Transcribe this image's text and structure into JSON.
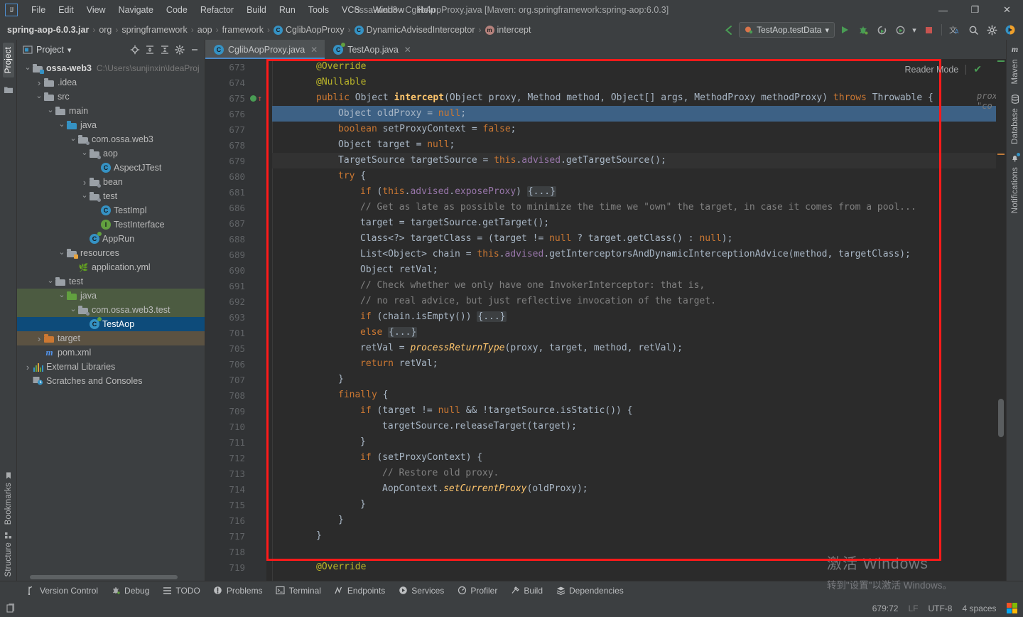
{
  "window": {
    "title": "ossa-web3 - CglibAopProxy.java [Maven: org.springframework:spring-aop:6.0.3]",
    "logo_text": "IJ",
    "minimize": "—",
    "maximize": "❐",
    "close": "✕"
  },
  "menubar": {
    "items": [
      "File",
      "Edit",
      "View",
      "Navigate",
      "Code",
      "Refactor",
      "Build",
      "Run",
      "Tools",
      "VCS",
      "Window",
      "Help"
    ]
  },
  "breadcrumb": {
    "items": [
      {
        "label": "spring-aop-6.0.3.jar",
        "icon": "",
        "bold": true
      },
      {
        "label": "org",
        "icon": ""
      },
      {
        "label": "springframework",
        "icon": ""
      },
      {
        "label": "aop",
        "icon": ""
      },
      {
        "label": "framework",
        "icon": ""
      },
      {
        "label": "CglibAopProxy",
        "icon": "class-icon"
      },
      {
        "label": "DynamicAdvisedInterceptor",
        "icon": "class-icon"
      },
      {
        "label": "intercept",
        "icon": "method-icon"
      }
    ],
    "separator": "›"
  },
  "toolbar": {
    "run_config": "TestAop.testData",
    "run_config_chevron": "▾",
    "icons": [
      {
        "name": "run-icon",
        "glyph": "▶"
      },
      {
        "name": "debug-icon",
        "glyph": "🐞"
      },
      {
        "name": "run-with-coverage-icon",
        "glyph": "↻"
      },
      {
        "name": "profiler-run-icon",
        "glyph": "⟳"
      },
      {
        "name": "stop-icon",
        "glyph": "■"
      },
      {
        "name": "translate-icon",
        "glyph": "文A"
      },
      {
        "name": "search-everywhere-icon",
        "glyph": "🔍"
      },
      {
        "name": "settings-icon",
        "glyph": "⚙"
      },
      {
        "name": "ide-assistant-icon",
        "glyph": "◗"
      }
    ],
    "back_arrow": "↖"
  },
  "left_strip": {
    "top": "Project",
    "bottom": [
      "Bookmarks",
      "Structure"
    ]
  },
  "right_strip": {
    "items": [
      "Maven",
      "Database",
      "Notifications"
    ]
  },
  "project_panel": {
    "title": "Project",
    "chevron": "▾",
    "actions": [
      "locate-icon",
      "expand-all-icon",
      "collapse-all-icon",
      "settings-icon",
      "hide-icon"
    ],
    "tree": [
      {
        "depth": 0,
        "arrow": "▾",
        "icon": "module-folder",
        "label": "ossa-web3",
        "bold": true,
        "hint": "C:\\Users\\sunjinxin\\IdeaProj",
        "state": "none"
      },
      {
        "depth": 1,
        "arrow": "›",
        "icon": "folder",
        "label": ".idea",
        "state": "none"
      },
      {
        "depth": 1,
        "arrow": "▾",
        "icon": "folder",
        "label": "src",
        "state": "none"
      },
      {
        "depth": 2,
        "arrow": "▾",
        "icon": "folder",
        "label": "main",
        "state": "none"
      },
      {
        "depth": 3,
        "arrow": "▾",
        "icon": "folder-blue",
        "label": "java",
        "state": "none"
      },
      {
        "depth": 4,
        "arrow": "▾",
        "icon": "package",
        "label": "com.ossa.web3",
        "state": "none"
      },
      {
        "depth": 5,
        "arrow": "▾",
        "icon": "package",
        "label": "aop",
        "state": "none"
      },
      {
        "depth": 6,
        "arrow": "",
        "icon": "class",
        "label": "AspectJTest",
        "state": "none"
      },
      {
        "depth": 5,
        "arrow": "›",
        "icon": "package",
        "label": "bean",
        "state": "none"
      },
      {
        "depth": 5,
        "arrow": "▾",
        "icon": "package",
        "label": "test",
        "state": "none"
      },
      {
        "depth": 6,
        "arrow": "",
        "icon": "class",
        "label": "TestImpl",
        "state": "none"
      },
      {
        "depth": 6,
        "arrow": "",
        "icon": "interface",
        "label": "TestInterface",
        "state": "none"
      },
      {
        "depth": 5,
        "arrow": "",
        "icon": "runnable-class",
        "label": "AppRun",
        "state": "none"
      },
      {
        "depth": 3,
        "arrow": "▾",
        "icon": "resources-folder",
        "label": "resources",
        "state": "none"
      },
      {
        "depth": 4,
        "arrow": "",
        "icon": "yaml",
        "label": "application.yml",
        "state": "none"
      },
      {
        "depth": 2,
        "arrow": "▾",
        "icon": "folder",
        "label": "test",
        "state": "none"
      },
      {
        "depth": 3,
        "arrow": "▾",
        "icon": "folder-green",
        "label": "java",
        "state": "green"
      },
      {
        "depth": 4,
        "arrow": "▾",
        "icon": "package",
        "label": "com.ossa.web3.test",
        "state": "green"
      },
      {
        "depth": 5,
        "arrow": "",
        "icon": "runnable-class",
        "label": "TestAop",
        "state": "blue"
      },
      {
        "depth": 1,
        "arrow": "›",
        "icon": "folder-orange",
        "label": "target",
        "state": "brown"
      },
      {
        "depth": 1,
        "arrow": "",
        "icon": "maven",
        "label": "pom.xml",
        "state": "none"
      },
      {
        "depth": 0,
        "arrow": "›",
        "icon": "libraries",
        "label": "External Libraries",
        "state": "none"
      },
      {
        "depth": 0,
        "arrow": "",
        "icon": "scratches",
        "label": "Scratches and Consoles",
        "state": "none"
      }
    ]
  },
  "tabs": [
    {
      "label": "CglibAopProxy.java",
      "icon": "class-icon",
      "active": true,
      "close": "✕"
    },
    {
      "label": "TestAop.java",
      "icon": "runnable-class-icon",
      "active": false,
      "close": "✕"
    }
  ],
  "editor": {
    "reader_mode_label": "Reader Mode",
    "reader_mode_check": "✔",
    "inlay_hint": "proxy: \"co",
    "lines": [
      {
        "num": "673",
        "fold": "minus",
        "indent": 2,
        "html": "<span class=\"ann\">@Override</span>"
      },
      {
        "num": "674",
        "fold": "bar",
        "indent": 2,
        "html": "<span class=\"ann\">@Nullable</span>"
      },
      {
        "num": "675",
        "fold": "minus",
        "gutter_run": true,
        "indent": 2,
        "html": "<span class=\"kw\">public</span> Object <span class=\"mname\">intercept</span>(Object proxy, Method method, Object[] args, MethodProxy methodProxy) <span class=\"kw\">throws</span> Throwable {"
      },
      {
        "num": "676",
        "highlight": true,
        "indent": 3,
        "html": "Object oldProxy = <span class=\"kw\">null</span>;"
      },
      {
        "num": "677",
        "indent": 3,
        "html": "<span class=\"kw\">boolean</span> setProxyContext = <span class=\"kw\">false</span>;"
      },
      {
        "num": "678",
        "indent": 3,
        "html": "Object target = <span class=\"kw\">null</span>;"
      },
      {
        "num": "679",
        "soft": true,
        "indent": 3,
        "html": "TargetSource targetSource = <span class=\"kw\">this</span>.<span class=\"fld\">advised</span>.getTargetSource();"
      },
      {
        "num": "680",
        "fold": "minus",
        "indent": 3,
        "html": "<span class=\"kw\">try</span> {"
      },
      {
        "num": "681",
        "fold": "plus",
        "indent": 4,
        "html": "<span class=\"kw\">if</span> (<span class=\"kw\">this</span>.<span class=\"fld\">advised</span>.<span class=\"fld\">exposeProxy</span>) <span class=\"dots\">{...}</span>"
      },
      {
        "num": "686",
        "indent": 4,
        "html": "<span class=\"cmt\">// Get as late as possible to minimize the time we \"own\" the target, in case it comes from a pool...</span>"
      },
      {
        "num": "687",
        "indent": 4,
        "html": "target = targetSource.getTarget();"
      },
      {
        "num": "688",
        "indent": 4,
        "html": "Class&lt;?&gt; targetClass = (target != <span class=\"kw\">null</span> ? target.getClass() : <span class=\"kw\">null</span>);"
      },
      {
        "num": "689",
        "indent": 4,
        "html": "List&lt;Object&gt; chain = <span class=\"kw\">this</span>.<span class=\"fld\">advised</span>.getInterceptorsAndDynamicInterceptionAdvice(method, targetClass);"
      },
      {
        "num": "690",
        "indent": 4,
        "html": "Object retVal;"
      },
      {
        "num": "691",
        "fold": "minus",
        "indent": 4,
        "html": "<span class=\"cmt\">// Check whether we only have one InvokerInterceptor: that is,</span>"
      },
      {
        "num": "692",
        "fold": "bar",
        "indent": 4,
        "html": "<span class=\"cmt\">// no real advice, but just reflective invocation of the target.</span>"
      },
      {
        "num": "693",
        "fold": "plus",
        "indent": 4,
        "html": "<span class=\"kw\">if</span> (chain.isEmpty()) <span class=\"dots\">{...}</span>"
      },
      {
        "num": "701",
        "fold": "plus",
        "indent": 4,
        "html": "<span class=\"kw\">else</span> <span class=\"dots\">{...}</span>"
      },
      {
        "num": "705",
        "indent": 4,
        "html": "retVal = <span class=\"sfn\">processReturnType</span>(proxy, target, method, retVal);"
      },
      {
        "num": "706",
        "indent": 4,
        "html": "<span class=\"kw\">return</span> retVal;"
      },
      {
        "num": "707",
        "fold": "bar",
        "indent": 3,
        "html": "}"
      },
      {
        "num": "708",
        "fold": "minus",
        "indent": 3,
        "html": "<span class=\"kw\">finally</span> {"
      },
      {
        "num": "709",
        "fold": "minus",
        "indent": 4,
        "html": "<span class=\"kw\">if</span> (target != <span class=\"kw\">null</span> &amp;&amp; !targetSource.isStatic()) {"
      },
      {
        "num": "710",
        "indent": 5,
        "html": "targetSource.releaseTarget(target);"
      },
      {
        "num": "711",
        "fold": "bar",
        "indent": 4,
        "html": "}"
      },
      {
        "num": "712",
        "fold": "minus",
        "indent": 4,
        "html": "<span class=\"kw\">if</span> (setProxyContext) {"
      },
      {
        "num": "713",
        "indent": 5,
        "html": "<span class=\"cmt\">// Restore old proxy.</span>"
      },
      {
        "num": "714",
        "indent": 5,
        "html": "AopContext.<span class=\"sfn\">setCurrentProxy</span>(oldProxy);"
      },
      {
        "num": "715",
        "fold": "bar",
        "indent": 4,
        "html": "}"
      },
      {
        "num": "716",
        "fold": "bar",
        "indent": 3,
        "html": "}"
      },
      {
        "num": "717",
        "fold": "bar",
        "indent": 2,
        "html": "}"
      },
      {
        "num": "718",
        "indent": 2,
        "html": ""
      },
      {
        "num": "719",
        "indent": 2,
        "html": "<span class=\"ann\">@Override</span>"
      }
    ]
  },
  "watermark": {
    "line1": "激活 Windows",
    "line2": "转到\"设置\"以激活 Windows。"
  },
  "bottom_bar": {
    "items": [
      {
        "label": "Version Control",
        "icon": "branch-icon"
      },
      {
        "label": "Debug",
        "icon": "debug-icon"
      },
      {
        "label": "TODO",
        "icon": "todo-icon"
      },
      {
        "label": "Problems",
        "icon": "problems-icon"
      },
      {
        "label": "Terminal",
        "icon": "terminal-icon"
      },
      {
        "label": "Endpoints",
        "icon": "endpoints-icon"
      },
      {
        "label": "Services",
        "icon": "services-icon"
      },
      {
        "label": "Profiler",
        "icon": "profiler-icon"
      },
      {
        "label": "Build",
        "icon": "build-icon"
      },
      {
        "label": "Dependencies",
        "icon": "dependencies-icon"
      }
    ]
  },
  "statusbar": {
    "left_icon": "ide-widget-icon",
    "caret_position": "679:72",
    "line_separator": "LF",
    "encoding": "UTF-8",
    "indent": "4 spaces",
    "windows_logo": "windows-logo-icon"
  },
  "colors": {
    "accent_blue": "#4a88c7",
    "selection_blue": "#3d6185",
    "annotation_red": "#ff1a1a",
    "editor_bg": "#2b2b2b",
    "panel_bg": "#3c3f41"
  }
}
